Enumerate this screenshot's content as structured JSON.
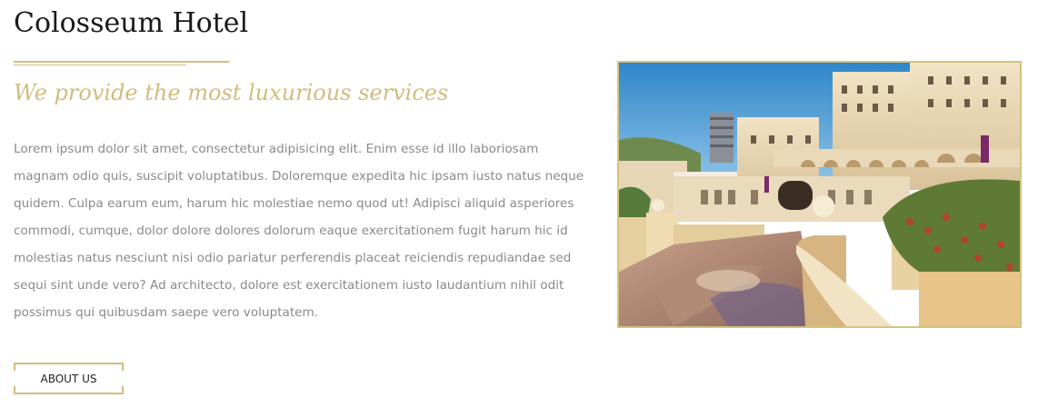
{
  "page": {
    "title": "Colosseum Hotel",
    "tagline": "We provide the most luxurious services",
    "body": "Lorem ipsum dolor sit amet, consectetur adipisicing elit. Enim esse id illo laboriosam magnam odio quis, suscipit voluptatibus. Doloremque expedita hic ipsam iusto natus neque quidem. Culpa earum eum, harum hic molestiae nemo quod ut! Adipisci aliquid asperiores commodi, cumque, dolor dolore dolores dolorum eaque exercitationem fugit harum hic id molestias natus nesciunt nisi odio pariatur perferendis placeat reiciendis repudiandae sed sequi sint unde vero? Ad architecto, dolore est exercitationem iusto laudantium nihil odit possimus qui quibusdam saepe vero voluptatem.",
    "button_label": "ABOUT US"
  },
  "colors": {
    "accent_gold": "#d2bc7c",
    "text_gray": "#8a8a8a",
    "title_dark": "#1a1a1a"
  },
  "image": {
    "subject": "hotel-terrace-photo"
  }
}
